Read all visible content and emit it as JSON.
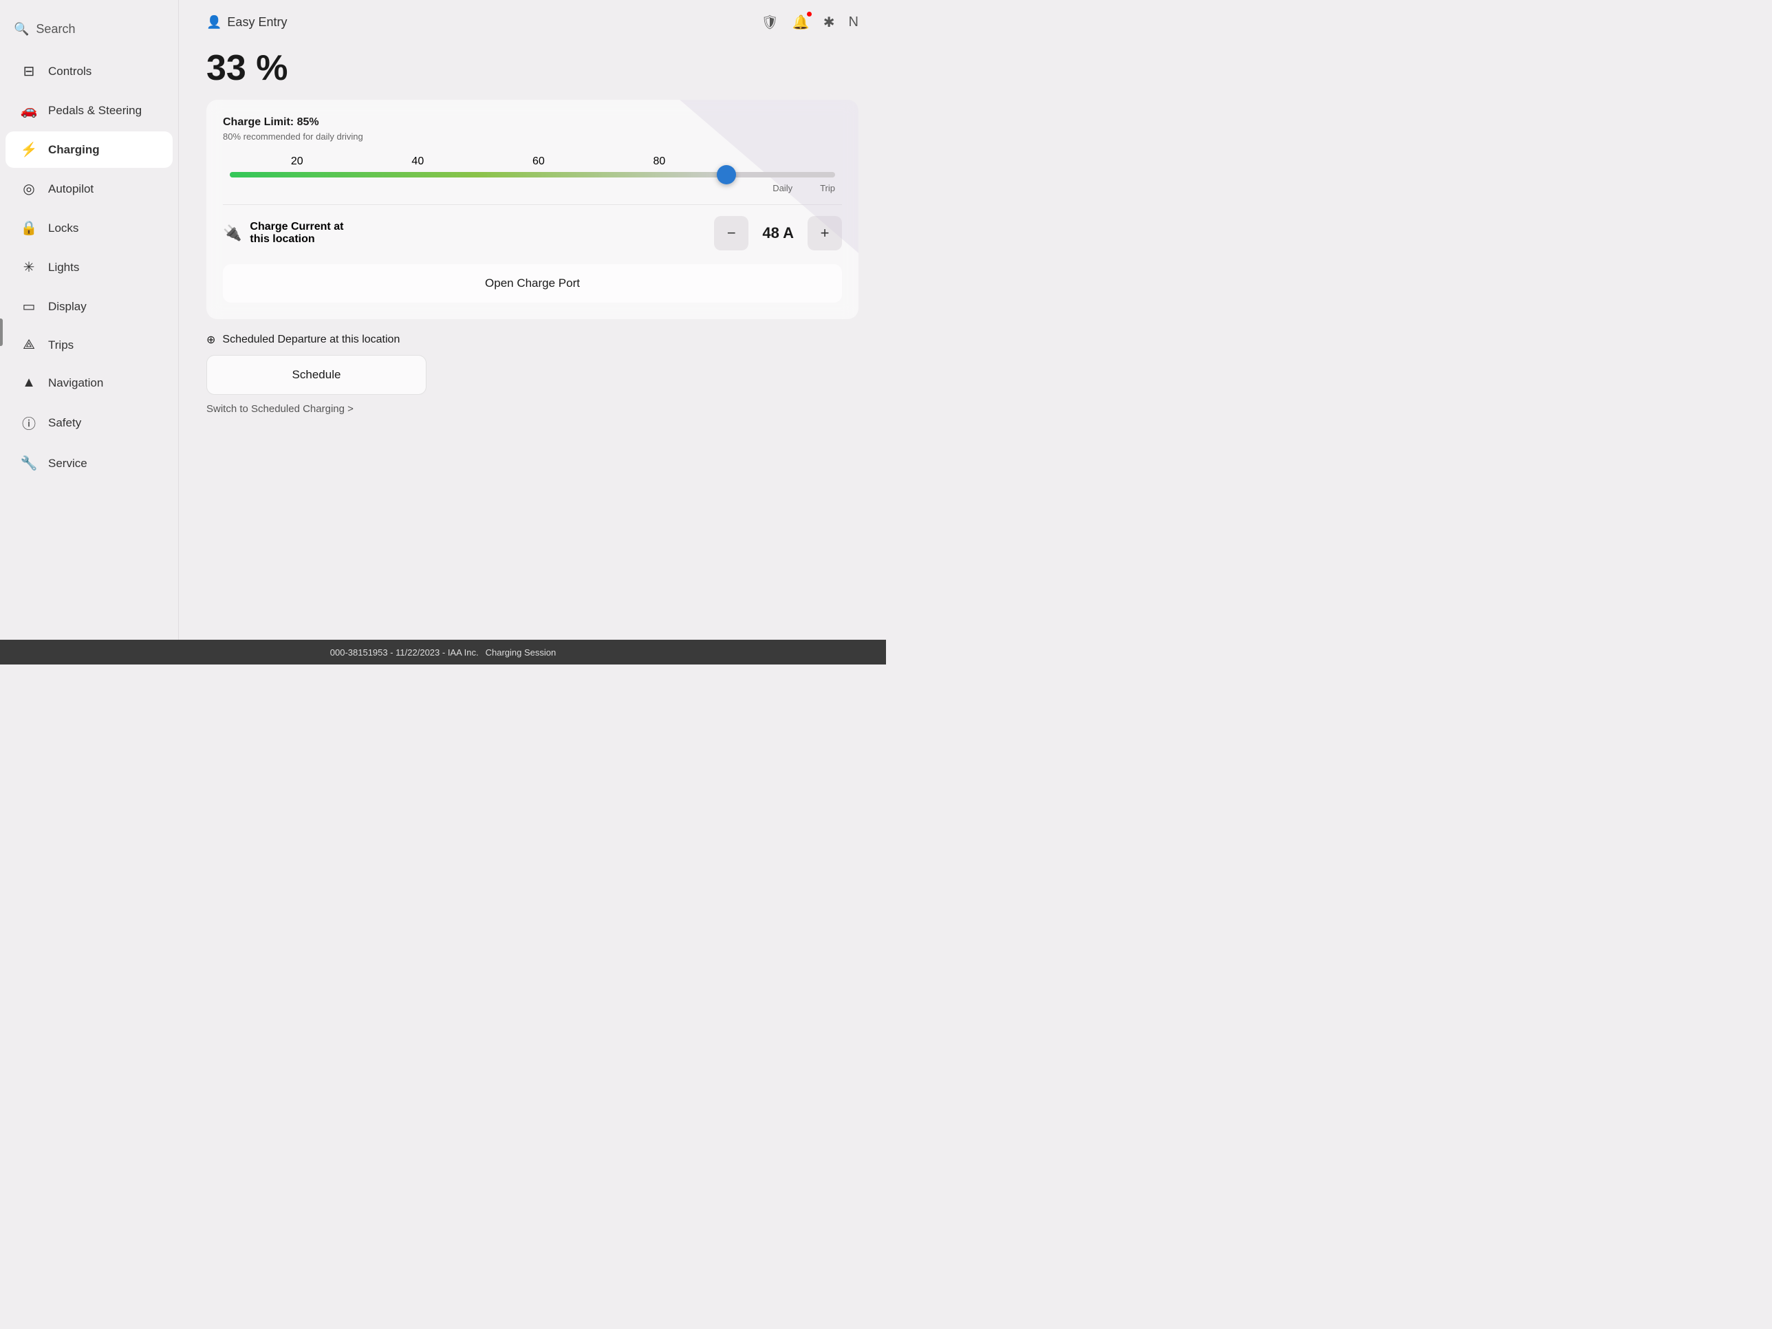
{
  "sidebar": {
    "search_label": "Search",
    "items": [
      {
        "id": "controls",
        "label": "Controls",
        "icon": "⊟"
      },
      {
        "id": "pedals",
        "label": "Pedals & Steering",
        "icon": "🚗"
      },
      {
        "id": "charging",
        "label": "Charging",
        "icon": "⚡",
        "active": true
      },
      {
        "id": "autopilot",
        "label": "Autopilot",
        "icon": "◎"
      },
      {
        "id": "locks",
        "label": "Locks",
        "icon": "🔒"
      },
      {
        "id": "lights",
        "label": "Lights",
        "icon": "✳"
      },
      {
        "id": "display",
        "label": "Display",
        "icon": "▭"
      },
      {
        "id": "trips",
        "label": "Trips",
        "icon": "⟁"
      },
      {
        "id": "navigation",
        "label": "Navigation",
        "icon": "▲"
      },
      {
        "id": "safety",
        "label": "Safety",
        "icon": "ⓘ"
      },
      {
        "id": "service",
        "label": "Service",
        "icon": "🔧"
      }
    ]
  },
  "topbar": {
    "easy_entry_label": "Easy Entry",
    "icons": [
      "🛡",
      "🔔",
      "✱",
      "N"
    ]
  },
  "main": {
    "battery_percentage": "33 %",
    "charge_card": {
      "charge_limit_label": "Charge Limit: 85%",
      "charge_limit_sub": "80% recommended for daily driving",
      "slider_marks": [
        "20",
        "40",
        "60",
        "80"
      ],
      "daily_label": "Daily",
      "trip_label": "Trip",
      "slider_value": 85
    },
    "charge_current": {
      "label_line1": "Charge Current at",
      "label_line2": "this location",
      "value": "48 A",
      "decrease_btn": "−",
      "increase_btn": "+"
    },
    "open_charge_port_btn": "Open Charge Port",
    "scheduled_departure_label": "Scheduled Departure at this location",
    "schedule_btn_label": "Schedule",
    "switch_charging_link": "Switch to Scheduled Charging >"
  },
  "bottom_bar": {
    "text": "000-38151953 - 11/22/2023 - IAA Inc.",
    "suffix": "Charging Session"
  }
}
